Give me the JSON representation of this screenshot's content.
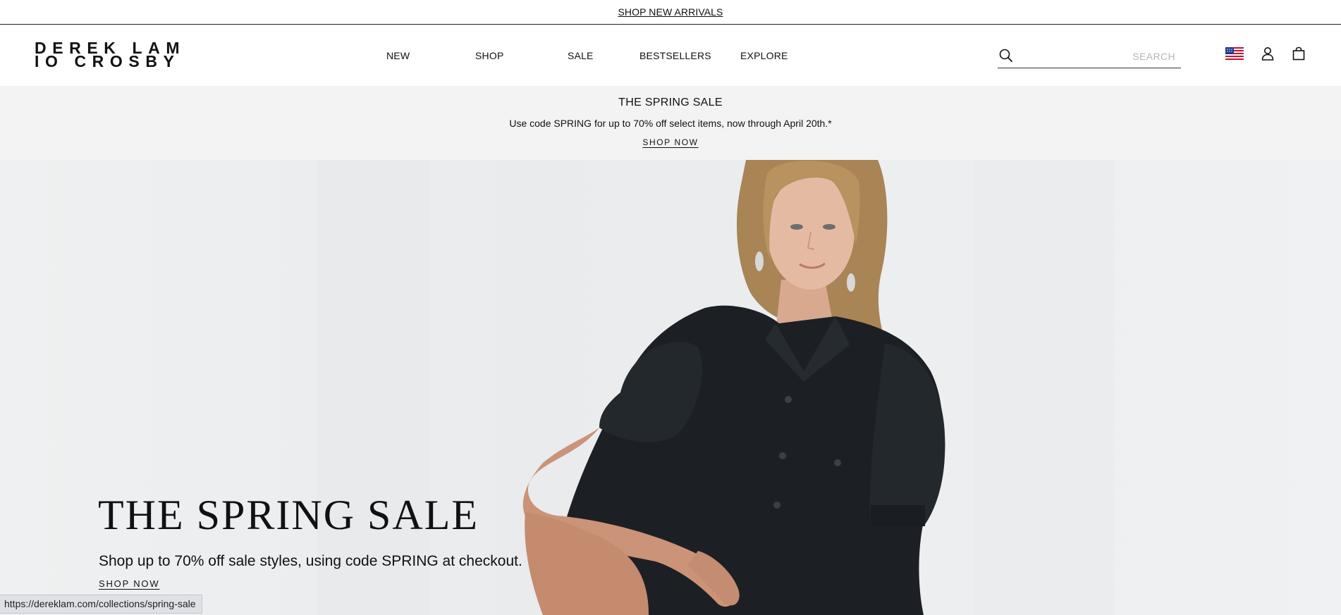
{
  "announcement": {
    "link_text": "SHOP NEW ARRIVALS"
  },
  "header": {
    "logo": {
      "line1": "DEREK LAM",
      "line2": "IO CROSBY"
    },
    "nav": [
      "NEW",
      "SHOP",
      "SALE",
      "BESTSELLERS",
      "EXPLORE"
    ],
    "search": {
      "placeholder": "SEARCH",
      "value": ""
    },
    "icons": [
      "search-icon",
      "us-flag-icon",
      "account-icon",
      "bag-icon"
    ]
  },
  "promo": {
    "title": "THE SPRING SALE",
    "text": "Use code SPRING for up to 70% off select items, now through April 20th.*",
    "link": "SHOP NOW"
  },
  "hero": {
    "title": "THE SPRING SALE",
    "subtitle": "Shop up to 70% off sale styles, using code SPRING at checkout.",
    "link": "SHOP NOW"
  },
  "status_bar": {
    "url": "https://dereklam.com/collections/spring-sale"
  },
  "colors": {
    "text": "#111111",
    "promo_bg": "#f3f3f3",
    "hero_bg": "#eceef0",
    "dress": "#1c2024"
  }
}
